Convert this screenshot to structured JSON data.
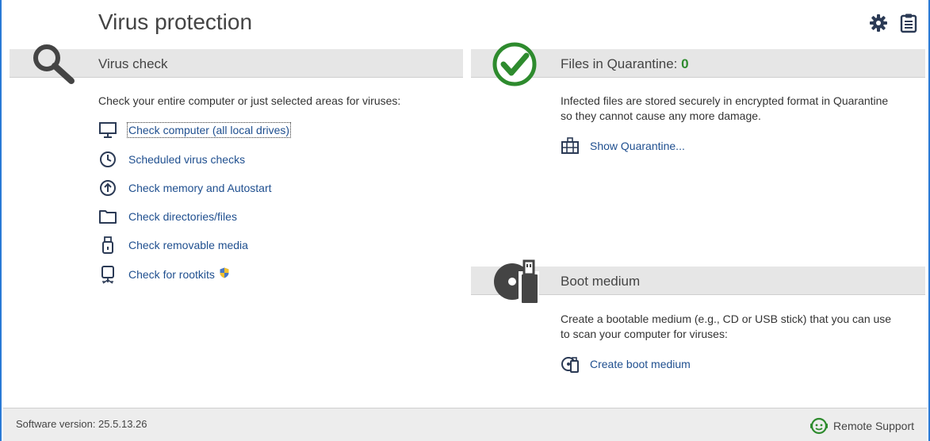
{
  "page": {
    "title": "Virus protection"
  },
  "toolbar": {
    "settings_icon": "gear-icon",
    "log_icon": "clipboard-icon"
  },
  "virus_check": {
    "title": "Virus check",
    "icon": "magnifier-icon",
    "description": "Check your entire computer or just selected areas for viruses:",
    "links": [
      {
        "label": "Check computer (all local drives)",
        "icon": "monitor-icon"
      },
      {
        "label": "Scheduled virus checks",
        "icon": "clock-icon"
      },
      {
        "label": "Check memory and Autostart",
        "icon": "arrow-up-circle-icon"
      },
      {
        "label": "Check directories/files",
        "icon": "folder-icon"
      },
      {
        "label": "Check removable media",
        "icon": "usb-stick-icon"
      },
      {
        "label": "Check for rootkits",
        "icon": "rootkit-icon"
      }
    ]
  },
  "quarantine": {
    "title_prefix": "Files in Quarantine: ",
    "count": "0",
    "icon": "checkmark-circle-icon",
    "description_line1": "Infected files are stored securely in encrypted format in Quarantine",
    "description_line2": "so they cannot cause any more damage.",
    "link_label": "Show Quarantine...",
    "link_icon": "quarantine-icon"
  },
  "boot_medium": {
    "title": "Boot medium",
    "icon": "boot-medium-icon",
    "description_line1": "Create a bootable medium (e.g., CD or USB stick) that you can use",
    "description_line2": "to scan your computer for viruses:",
    "link_label": "Create boot medium",
    "link_icon": "create-boot-icon"
  },
  "footer": {
    "version_text": "Software version: 25.5.13.26",
    "remote_support_label": "Remote Support",
    "remote_support_icon": "headset-icon"
  },
  "colors": {
    "accent_blue": "#2a7ad6",
    "link_blue": "#1f4f8f",
    "quarantine_green": "#2e8b2e",
    "section_bar": "#e6e6e6",
    "icon_dark": "#444444"
  }
}
